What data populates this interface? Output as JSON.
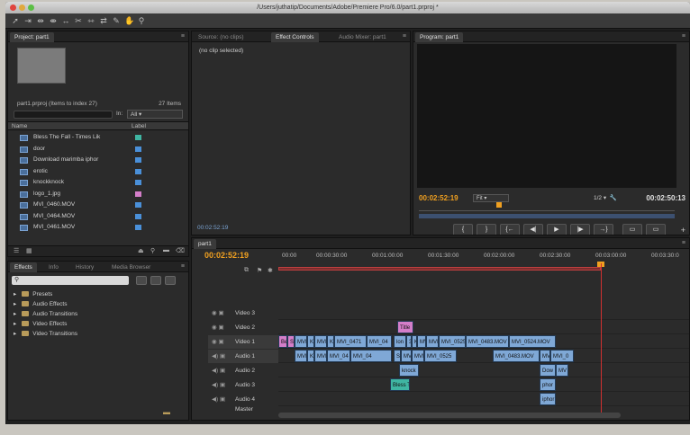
{
  "window": {
    "title": "/Users/juthatip/Documents/Adobe/Premiere Pro/6.0/part1.prproj *"
  },
  "toolbar": {
    "tools": [
      "selection-tool",
      "track-select-tool",
      "ripple-edit-tool",
      "rolling-edit-tool",
      "rate-stretch-tool",
      "razor-tool",
      "slip-tool",
      "slide-tool",
      "pen-tool",
      "hand-tool",
      "zoom-tool"
    ]
  },
  "project": {
    "tab": "Project: part1",
    "file_info": "part1.prproj (Items to index 27)",
    "item_count": "27 Items",
    "in_label": "In:",
    "in_value": "All",
    "col_name": "Name",
    "col_label": "Label",
    "items": [
      {
        "name": "Bless The Fall - Times Lik",
        "color": "#3fb5a2"
      },
      {
        "name": "door",
        "color": "#4a90d9"
      },
      {
        "name": "Download marimba iphor",
        "color": "#4a90d9"
      },
      {
        "name": "erotic",
        "color": "#4a90d9"
      },
      {
        "name": "knockknock",
        "color": "#4a90d9"
      },
      {
        "name": "logo_1.jpg",
        "color": "#d47ec9"
      },
      {
        "name": "MVI_0460.MOV",
        "color": "#4a90d9"
      },
      {
        "name": "MVI_0464.MOV",
        "color": "#4a90d9"
      },
      {
        "name": "MVI_0461.MOV",
        "color": "#4a90d9"
      }
    ]
  },
  "effects": {
    "tabs": [
      "Effects",
      "Info",
      "History",
      "Media Browser"
    ],
    "folders": [
      "Presets",
      "Audio Effects",
      "Audio Transitions",
      "Video Effects",
      "Video Transitions"
    ]
  },
  "effect_controls": {
    "tabs": [
      "Source: (no clips)",
      "Effect Controls",
      "Audio Mixer: part1"
    ],
    "no_clip": "(no clip selected)",
    "time": "00:02:52:19"
  },
  "program": {
    "tab": "Program: part1",
    "timecode": "00:02:52:19",
    "fit": "Fit",
    "resolution": "1/2",
    "duration": "00:02:50:13",
    "controls": [
      "{",
      "}",
      "{←",
      "◀|",
      "▶",
      "|▶",
      "→}"
    ]
  },
  "timeline": {
    "tab": "part1",
    "timecode": "00:02:52:19",
    "ruler": [
      "00:00",
      "00:00:30:00",
      "00:01:00:00",
      "00:01:30:00",
      "00:02:00:00",
      "00:02:30:00",
      "00:03:00:00",
      "00:03:30:0"
    ],
    "video_tracks": [
      "Video 3",
      "Video 2",
      "Video 1"
    ],
    "audio_tracks": [
      "Audio 1",
      "Audio 2",
      "Audio 3",
      "Audio 4"
    ],
    "v2_clips": [
      {
        "label": "Title"
      }
    ],
    "v1_clips": [
      {
        "label": "Be"
      },
      {
        "label": "S"
      },
      {
        "label": "MVI_0"
      },
      {
        "label": "K"
      },
      {
        "label": "MVI_0"
      },
      {
        "label": "K"
      },
      {
        "label": "MVI_0471"
      },
      {
        "label": "MVI_04"
      },
      {
        "label": "lon"
      },
      {
        "label": "3"
      },
      {
        "label": "K"
      },
      {
        "label": "MV"
      },
      {
        "label": "MVI_"
      },
      {
        "label": "MVI_0525"
      },
      {
        "label": "MVI_0483.MOV"
      },
      {
        "label": "MVI_0524.MOV"
      }
    ],
    "a1_clips": [
      {
        "label": "MVI_0"
      },
      {
        "label": "K"
      },
      {
        "label": "MVI_0"
      },
      {
        "label": "MVI_04"
      },
      {
        "label": "MVI_04"
      },
      {
        "label": "S"
      },
      {
        "label": "MV"
      },
      {
        "label": "MVI_"
      },
      {
        "label": "MVI_0525"
      },
      {
        "label": "MVI_0483.MOV"
      },
      {
        "label": "MVI"
      },
      {
        "label": "MVI_0"
      }
    ],
    "a2_clips": [
      {
        "label": "knock"
      },
      {
        "label": "Dow"
      },
      {
        "label": "MV"
      }
    ],
    "a3_clips": [
      {
        "label": "Bless T"
      },
      {
        "label": "phor"
      }
    ],
    "a4_clips": [
      {
        "label": "iphor"
      }
    ],
    "master": "Master"
  }
}
